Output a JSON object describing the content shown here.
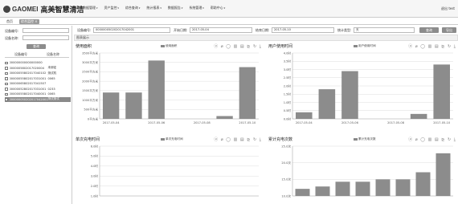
{
  "header": {
    "logo_en": "GAOMEI",
    "logo_cn": "高美智慧清洁",
    "nav": [
      "基础数据管理",
      "资产监控",
      "综合查询",
      "统计报表",
      "数据报告",
      "系统管理",
      "帮助中心"
    ],
    "user": "退出 test"
  },
  "tabs": [
    {
      "label": "首页"
    },
    {
      "label": "综合监控 ×"
    }
  ],
  "sidebar": {
    "device_code_label": "设备编号:",
    "device_name_label": "设备名称:",
    "search_button": "查询",
    "col_code": "设备编号",
    "col_name": "设备名称",
    "rows": [
      {
        "code": "000000000000000000",
        "name": "",
        "selected": false
      },
      {
        "code": "0000005802017020004",
        "name": "未绑定",
        "selected": false
      },
      {
        "code": "00000055802017040102",
        "name": "测试机",
        "selected": false
      },
      {
        "code": "00000055802017031001",
        "name": "0065",
        "selected": false
      },
      {
        "code": "00000065802017041507",
        "name": "",
        "selected": false
      },
      {
        "code": "00000052802017031001",
        "name": "0233",
        "selected": false
      },
      {
        "code": "00000055802017040001",
        "name": "0065",
        "selected": false
      },
      {
        "code": "000000050202017042001",
        "name": "测试测试",
        "selected": true
      }
    ]
  },
  "query": {
    "code_label": "设备编号:",
    "code_value": "000000050202017042001",
    "start_label": "开始日期:",
    "start_value": "2017-05-04",
    "end_label": "结束日期:",
    "end_value": "2017-05-10",
    "type_label": "统计类型:",
    "type_value": "天",
    "search_button": "查询",
    "export_button": "导出"
  },
  "section_title": "图表展示",
  "tools": "ⓐ ⌀ ◯ ▥ ▤ ⊵ ↻ ⤓",
  "colors": {
    "bar": "#8c8c8c",
    "axis": "#aaaaaa",
    "grid": "#dddddd",
    "text": "#555555"
  },
  "chart_data": [
    {
      "type": "bar",
      "title": "使用面积",
      "legend": "使用面积",
      "unit_ticks": [
        "0平方米",
        "500平方米",
        "1000平方米",
        "1500平方米",
        "2000平方米",
        "2500平方米",
        "3000平方米",
        "3500平方米"
      ],
      "ylim": [
        0,
        3500
      ],
      "categories": [
        "2017-05-04",
        "2017-05-05",
        "2017-05-06",
        "2017-05-07",
        "2017-05-08",
        "2017-05-09",
        "2017-05-10"
      ],
      "x_labels": [
        "2017-05-04",
        "2017-05-06",
        "2017-05-08",
        "2017-05-10"
      ],
      "values": [
        1400,
        1400,
        3100,
        0,
        0,
        150,
        2750
      ]
    },
    {
      "type": "bar",
      "title": "用户使用时间",
      "legend": "用户使用时间",
      "unit_ticks": [
        "0.0时",
        "0.5时",
        "1.0时",
        "1.5时",
        "2.0时",
        "2.5时",
        "3.0时",
        "3.5时",
        "4.0时"
      ],
      "ylim": [
        0,
        4
      ],
      "categories": [
        "2017-05-04",
        "2017-05-05",
        "2017-05-06",
        "2017-05-07",
        "2017-05-08",
        "2017-05-09",
        "2017-05-10"
      ],
      "x_labels": [
        "2017-05-04",
        "2017-05-06",
        "2017-05-08",
        "2017-05-10"
      ],
      "values": [
        0.4,
        1.8,
        2.9,
        0,
        0,
        0.3,
        3.3
      ]
    },
    {
      "type": "bar",
      "title": "单次充电时间",
      "legend": "单次充电时间",
      "unit_ticks": [
        "1.0时",
        "2.0时",
        "3.0时",
        "4.0时",
        "5.0时",
        "6.0时"
      ],
      "ylim": [
        0,
        6
      ],
      "categories": [],
      "x_labels": [],
      "values": []
    },
    {
      "type": "bar",
      "title": "累计充电次数",
      "legend": "累计充电次数",
      "unit_ticks": [
        "10.0次",
        "15.0次",
        "20.0次",
        "25.0次"
      ],
      "ylim": [
        7,
        28
      ],
      "categories": [
        "1",
        "2",
        "3",
        "4",
        "5",
        "6",
        "7",
        "8"
      ],
      "x_labels": [],
      "values": [
        10,
        11,
        13,
        13,
        14,
        14,
        17,
        25
      ]
    }
  ]
}
